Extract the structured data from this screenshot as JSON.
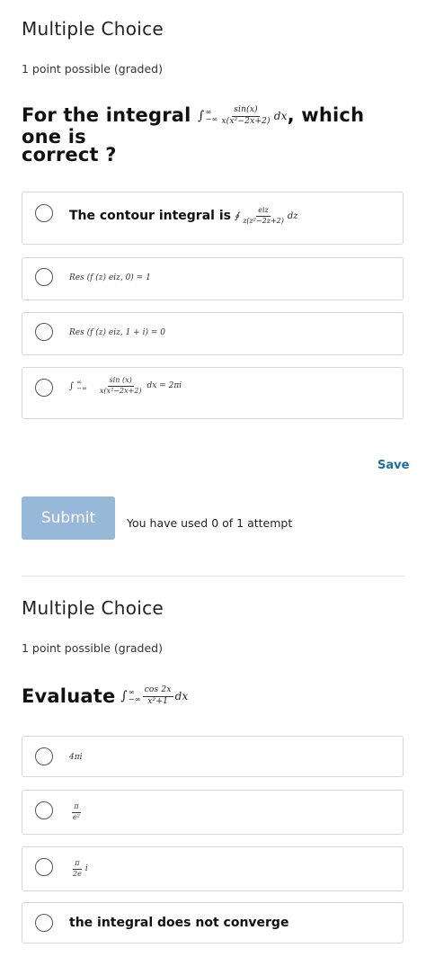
{
  "problem1": {
    "title": "Multiple Choice",
    "points": "1 point possible (graded)",
    "question_prefix": "For the integral",
    "question_integral": {
      "upper": "∞",
      "lower": "−∞",
      "numerator": "sin(x)",
      "denominator": "x(x²−2x+2)",
      "differential": "dx"
    },
    "question_suffix": ", which one is",
    "question_line2": "correct ?",
    "options": [
      {
        "label_prefix": "The contour integral is",
        "integral_sym": "∮",
        "numerator": "eiz",
        "denominator": "z(z²−2z+2)",
        "differential": "dz"
      },
      {
        "math": "Res (f (z) eiz, 0) = 1"
      },
      {
        "math": "Res (f (z) eiz, 1 + i) = 0"
      },
      {
        "integral_upper": "∞",
        "integral_lower": "−∞",
        "numerator": "sin (x)",
        "denominator": "x(x²−2x+2)",
        "rhs": "dx = 2πi"
      }
    ],
    "save_label": "Save",
    "submit_label": "Submit",
    "attempts_text": "You have used 0 of 1 attempt"
  },
  "problem2": {
    "title": "Multiple Choice",
    "points": "1 point possible (graded)",
    "question_prefix": "Evaluate",
    "question_integral": {
      "upper": "∞",
      "lower": "−∞",
      "numerator": "cos 2x",
      "denominator": "x²+1",
      "differential": "dx"
    },
    "options": [
      {
        "math": "4πi"
      },
      {
        "numerator": "π",
        "denominator": "e²"
      },
      {
        "numerator": "π",
        "denominator": "2e",
        "suffix": "i"
      },
      {
        "label": "the integral does not converge"
      }
    ]
  },
  "colors": {
    "submit_bg": "#98b8da",
    "save_link": "#1b6fa8",
    "border": "#d6d6d6"
  }
}
